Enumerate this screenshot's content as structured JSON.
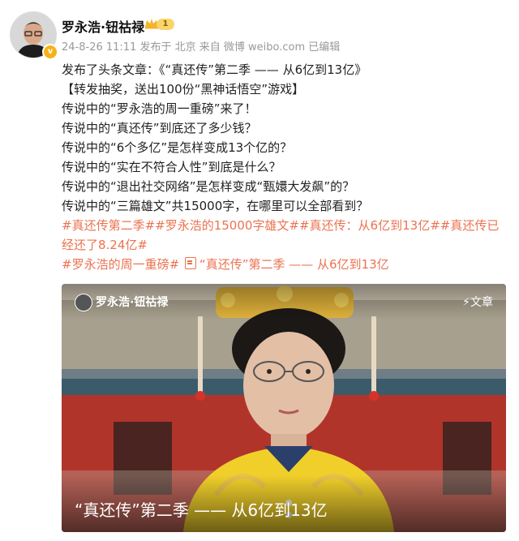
{
  "post": {
    "author": "罗永浩·钮祜禄",
    "level": "1",
    "meta": "24-8-26 11:11  发布于 北京  来自 微博 weibo.com  已编辑",
    "lines": [
      "发布了头条文章：《“真还传”第二季 —— 从6亿到13亿》",
      "【转发抽奖，送出100份“黑神话悟空”游戏】",
      "传说中的“罗永浩的周一重磅”来了！",
      "传说中的“真还传”到底还了多少钱？",
      "传说中的“6个多亿”是怎样变成13个亿的？",
      "传说中的“实在不符合人性”到底是什么？",
      "传说中的“退出社交网络”是怎样变成“甄嬛大发飙”的？",
      "传说中的“三篇雄文”共15000字，在哪里可以全部看到？"
    ],
    "topics_line": "#真还传第二季##罗永浩的15000字雄文##真还传：从6亿到13亿##真还传已经还了8.24亿#",
    "last_topic": "#罗永浩的周一重磅#",
    "article_link": "“真还传”第二季 —— 从6亿到13亿"
  },
  "card": {
    "author": "罗永浩·钮祜禄",
    "type_label": "文章",
    "title": "“真还传”第二季 —— 从6亿到13亿"
  },
  "colors": {
    "link": "#eb7350",
    "meta": "#999999",
    "text": "#222222"
  }
}
